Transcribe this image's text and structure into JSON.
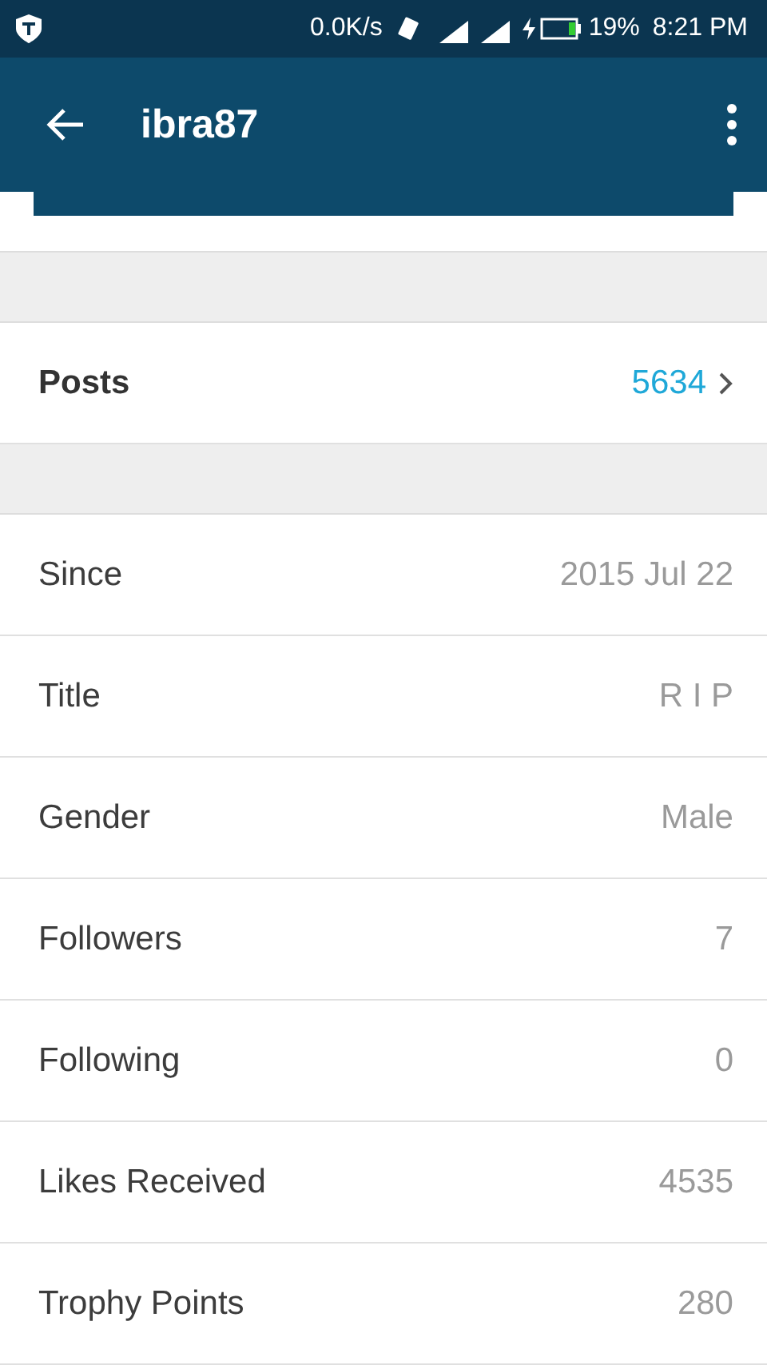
{
  "status_bar": {
    "speed": "0.0K/s",
    "battery": "19%",
    "time": "8:21 PM"
  },
  "app_bar": {
    "title": "ibra87"
  },
  "posts": {
    "label": "Posts",
    "value": "5634"
  },
  "details": [
    {
      "label": "Since",
      "value": "2015 Jul 22"
    },
    {
      "label": "Title",
      "value": "R I P"
    },
    {
      "label": "Gender",
      "value": "Male"
    },
    {
      "label": "Followers",
      "value": "7"
    },
    {
      "label": "Following",
      "value": "0"
    },
    {
      "label": "Likes Received",
      "value": "4535"
    },
    {
      "label": "Trophy Points",
      "value": "280"
    }
  ]
}
